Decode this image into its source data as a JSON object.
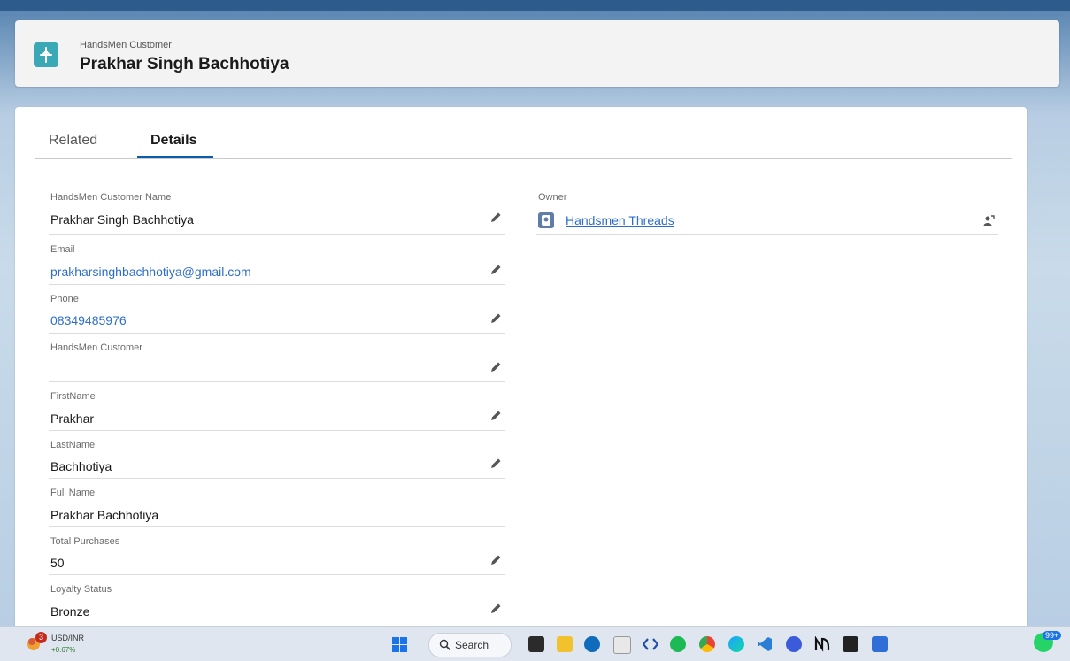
{
  "header": {
    "object_type": "HandsMen Customer",
    "record_title": "Prakhar Singh Bachhotiya"
  },
  "tabs": [
    {
      "label": "Related",
      "active": false
    },
    {
      "label": "Details",
      "active": true
    }
  ],
  "fields": [
    {
      "label": "HandsMen Customer Name",
      "value": "Prakhar Singh Bachhotiya",
      "link": false,
      "editable": true
    },
    {
      "label": "Email",
      "value": "prakharsinghbachhotiya@gmail.com",
      "link": true,
      "editable": true
    },
    {
      "label": "Phone",
      "value": "08349485976",
      "link": true,
      "editable": true
    },
    {
      "label": "HandsMen Customer",
      "value": "",
      "link": false,
      "editable": true
    },
    {
      "label": "FirstName",
      "value": "Prakhar",
      "link": false,
      "editable": true
    },
    {
      "label": "LastName",
      "value": "Bachhotiya",
      "link": false,
      "editable": true
    },
    {
      "label": "Full Name",
      "value": "Prakhar Bachhotiya",
      "link": false,
      "editable": false
    },
    {
      "label": "Total Purchases",
      "value": "50",
      "link": false,
      "editable": true
    },
    {
      "label": "Loyalty Status",
      "value": "Bronze",
      "link": false,
      "editable": true
    }
  ],
  "owner": {
    "label": "Owner",
    "value": "Handsmen Threads"
  },
  "taskbar": {
    "notification_count": "3",
    "ticker_name": "USD/INR",
    "ticker_change": "+0.67%",
    "search_label": "Search",
    "badge": "99+",
    "icons": [
      "file-explorer-icon",
      "folder-icon",
      "outlook-icon",
      "acrobat-icon",
      "devtools-icon",
      "spotify-icon",
      "chrome-icon",
      "edge-icon",
      "vscode-icon",
      "cortana-icon",
      "notion-icon",
      "terminal-icon",
      "calendar-icon",
      "whatsapp-icon"
    ]
  },
  "colors": {
    "brand_blue": "#0b5cab",
    "link_blue": "#2e6ec8",
    "object_icon_teal": "#3ba9b5",
    "owner_icon": "#5e7da8"
  }
}
